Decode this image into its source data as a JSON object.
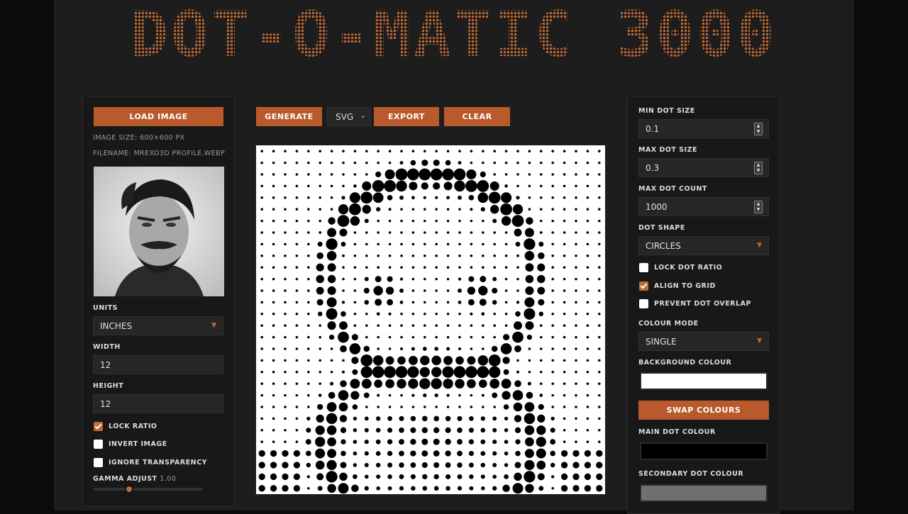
{
  "app": {
    "title": "DOT-O-MATIC 3000",
    "accent_color": "#b85a2b"
  },
  "toolbar": {
    "generate_label": "GENERATE",
    "format_value": "SVG",
    "export_label": "EXPORT",
    "clear_label": "CLEAR"
  },
  "left_panel": {
    "load_label": "LOAD IMAGE",
    "image_size": "IMAGE SIZE: 600×600 PX",
    "filename": "FILENAME: MREXO3D PROFILE.WEBP",
    "units_label": "UNITS",
    "units_value": "INCHES",
    "width_label": "WIDTH",
    "width_value": "12",
    "height_label": "HEIGHT",
    "height_value": "12",
    "lock_ratio_label": "LOCK RATIO",
    "lock_ratio_checked": true,
    "invert_label": "INVERT IMAGE",
    "invert_checked": false,
    "ignore_transparency_label": "IGNORE TRANSPARENCY",
    "ignore_transparency_checked": false,
    "gamma_label": "GAMMA ADJUST",
    "gamma_value": "1.00",
    "gamma_fraction": 0.33
  },
  "right_panel": {
    "min_dot_label": "MIN DOT SIZE",
    "min_dot_value": "0.1",
    "max_dot_label": "MAX DOT SIZE",
    "max_dot_value": "0.3",
    "max_count_label": "MAX DOT COUNT",
    "max_count_value": "1000",
    "shape_label": "DOT SHAPE",
    "shape_value": "CIRCLES",
    "lock_dot_ratio_label": "LOCK DOT RATIO",
    "lock_dot_ratio_checked": false,
    "align_grid_label": "ALIGN TO GRID",
    "align_grid_checked": true,
    "prevent_overlap_label": "PREVENT DOT OVERLAP",
    "prevent_overlap_checked": false,
    "colour_mode_label": "COLOUR MODE",
    "colour_mode_value": "SINGLE",
    "bg_colour_label": "BACKGROUND COLOUR",
    "bg_colour": "#ffffff",
    "swap_label": "SWAP COLOURS",
    "main_colour_label": "MAIN DOT COLOUR",
    "main_colour": "#000000",
    "secondary_colour_label": "SECONDARY DOT COLOUR",
    "secondary_colour": "#707070"
  }
}
